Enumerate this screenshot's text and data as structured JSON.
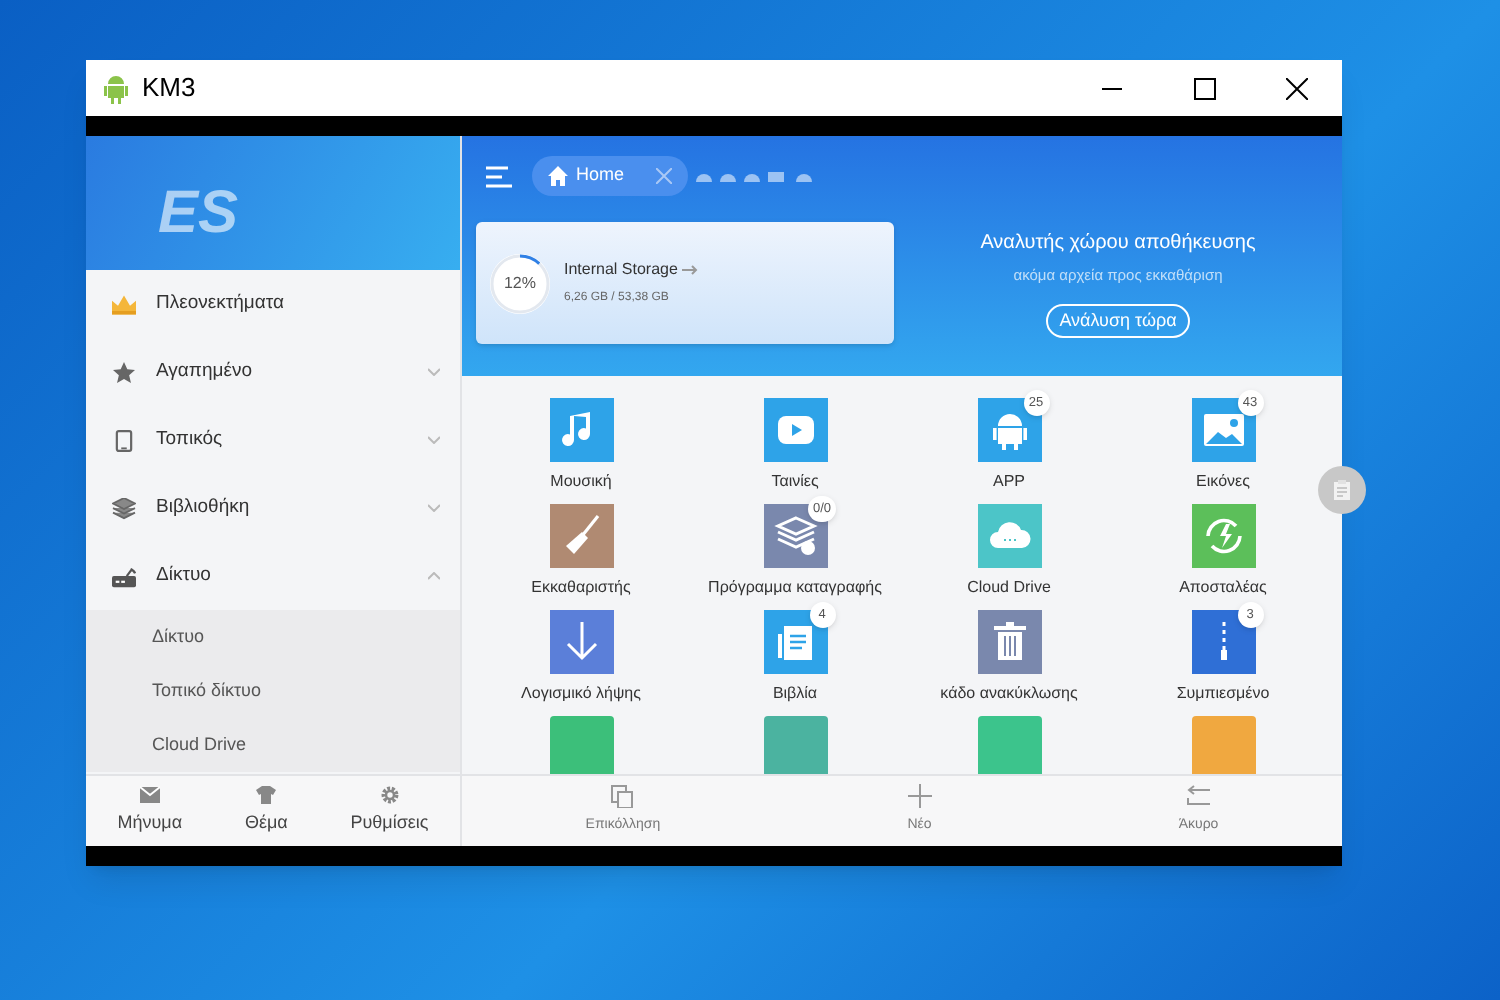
{
  "window": {
    "title": "KM3"
  },
  "sidebar": {
    "logo": "ES",
    "items": [
      {
        "label": "Πλεονεκτήματα",
        "kind": "crown"
      },
      {
        "label": "Αγαπημένο",
        "kind": "star",
        "expanded": false
      },
      {
        "label": "Τοπικός",
        "kind": "phone",
        "expanded": false
      },
      {
        "label": "Βιβλιοθήκη",
        "kind": "layers",
        "expanded": false
      },
      {
        "label": "Δίκτυο",
        "kind": "network",
        "expanded": true,
        "children": [
          {
            "label": "Δίκτυο"
          },
          {
            "label": "Τοπικό δίκτυο"
          },
          {
            "label": "Cloud Drive"
          }
        ]
      }
    ],
    "bottom": [
      {
        "label": "Μήνυμα",
        "kind": "mail"
      },
      {
        "label": "Θέμα",
        "kind": "shirt"
      },
      {
        "label": "Ρυθμίσεις",
        "kind": "gear"
      }
    ]
  },
  "tab": {
    "label": "Home"
  },
  "storage": {
    "name": "Internal Storage",
    "percent": "12%",
    "level": 0.12,
    "usage": "6,26 GB / 53,38 GB"
  },
  "analyzer": {
    "title": "Αναλυτής χώρου αποθήκευσης",
    "subtitle": "ακόμα αρχεία προς εκκαθάριση",
    "button": "Ανάλυση τώρα"
  },
  "tiles": [
    {
      "label": "Μουσική",
      "kind": "music",
      "color": "#2ea3e8"
    },
    {
      "label": "Ταινίες",
      "kind": "video",
      "color": "#2ea3e8"
    },
    {
      "label": "APP",
      "kind": "android",
      "color": "#2ea3e8",
      "badge": "25"
    },
    {
      "label": "Εικόνες",
      "kind": "image",
      "color": "#2ea3e8",
      "badge": "43"
    },
    {
      "label": "Εκκαθαριστής",
      "kind": "broom",
      "color": "#b08a72"
    },
    {
      "label": "Πρόγραμμα καταγραφής",
      "kind": "stack",
      "color": "#7a88ad",
      "badge": "0/0"
    },
    {
      "label": "Cloud Drive",
      "kind": "cloud",
      "color": "#4cc5c8"
    },
    {
      "label": "Αποσταλέας",
      "kind": "sync",
      "color": "#5cbf5a"
    },
    {
      "label": "Λογισμικό λήψης",
      "kind": "download",
      "color": "#5b7fd9"
    },
    {
      "label": "Βιβλία",
      "kind": "document",
      "color": "#2ea3e8",
      "badge": "4"
    },
    {
      "label": "κάδο ανακύκλωσης",
      "kind": "trash",
      "color": "#7a88ad"
    },
    {
      "label": "Συμπιεσμένο",
      "kind": "zip",
      "color": "#2f6fd6",
      "badge": "3"
    }
  ],
  "partial_tiles": [
    {
      "color": "#3cbf7a"
    },
    {
      "color": "#4bb3a0"
    },
    {
      "color": "#3cc48c"
    },
    {
      "color": "#f0a840"
    }
  ],
  "toolbar": [
    {
      "label": "Επικόλληση",
      "kind": "paste"
    },
    {
      "label": "Νέο",
      "kind": "plus"
    },
    {
      "label": "Άκυρο",
      "kind": "undo"
    }
  ]
}
